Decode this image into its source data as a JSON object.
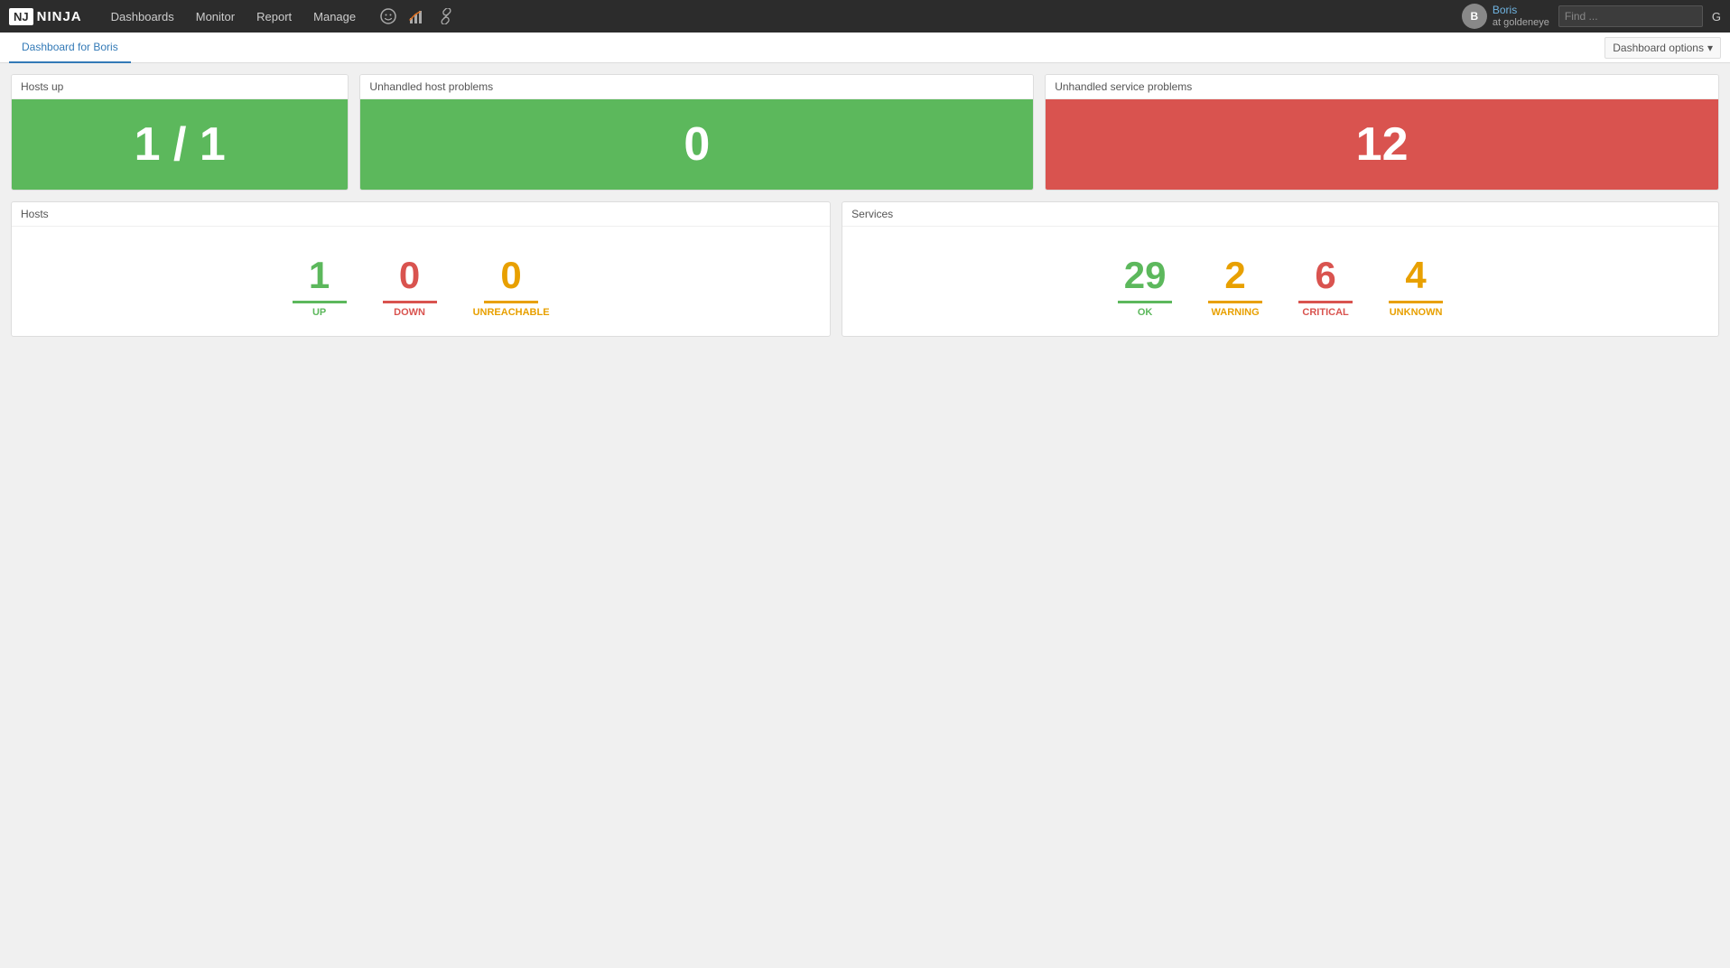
{
  "app": {
    "logo_ninja": "NJ",
    "logo_name": "NINJA"
  },
  "nav": {
    "items": [
      {
        "label": "Dashboards"
      },
      {
        "label": "Monitor"
      },
      {
        "label": "Report"
      },
      {
        "label": "Manage"
      }
    ]
  },
  "nav_icons": [
    {
      "name": "smiley-icon",
      "glyph": "☺"
    },
    {
      "name": "settings-icon",
      "glyph": "⚙"
    },
    {
      "name": "link-icon",
      "glyph": "🔗"
    }
  ],
  "user": {
    "name": "Boris",
    "host": "at goldeneye",
    "avatar_initials": "B"
  },
  "search": {
    "placeholder": "Find ..."
  },
  "subnav": {
    "active_tab": "Dashboard for Boris",
    "dashboard_options_label": "Dashboard options"
  },
  "top_panels": [
    {
      "label": "Hosts up",
      "value": "1 / 1",
      "bg": "green"
    },
    {
      "label": "Unhandled host problems",
      "value": "0",
      "bg": "green"
    },
    {
      "label": "Unhandled service problems",
      "value": "12",
      "bg": "red"
    }
  ],
  "hosts_panel": {
    "label": "Hosts",
    "stats": [
      {
        "value": "1",
        "label": "UP",
        "color": "green"
      },
      {
        "value": "0",
        "label": "DOWN",
        "color": "red"
      },
      {
        "value": "0",
        "label": "UNREACHABLE",
        "color": "orange"
      }
    ]
  },
  "services_panel": {
    "label": "Services",
    "stats": [
      {
        "value": "29",
        "label": "OK",
        "color": "green"
      },
      {
        "value": "2",
        "label": "WARNING",
        "color": "orange"
      },
      {
        "value": "6",
        "label": "CRITICAL",
        "color": "red"
      },
      {
        "value": "4",
        "label": "UNKNOWN",
        "color": "orange"
      }
    ]
  }
}
